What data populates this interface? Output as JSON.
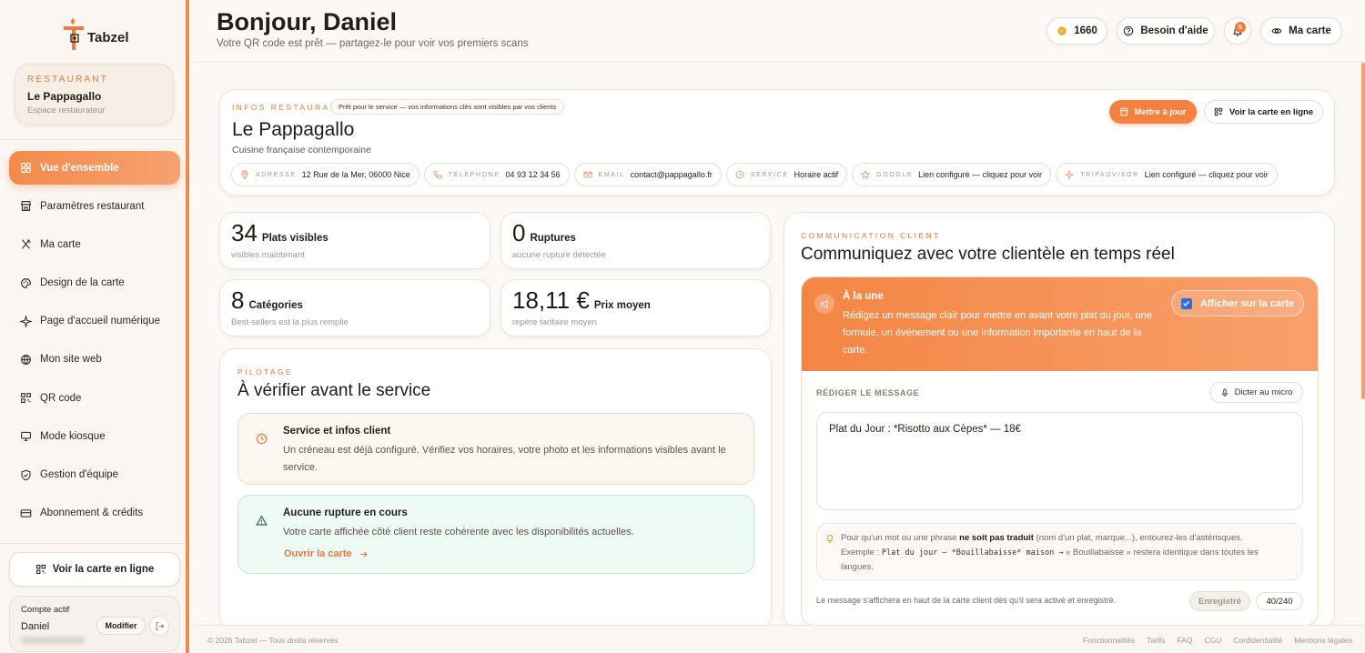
{
  "brand": {
    "name": "Tabzel",
    "accent": "#f4813f"
  },
  "sidebar": {
    "restaurant_label": "RESTAURANT",
    "restaurant_name": "Le Pappagallo",
    "restaurant_sub": "Espace restaurateur",
    "items": [
      {
        "label": "Vue d'ensemble",
        "icon": "grid-icon",
        "active": true
      },
      {
        "label": "Paramètres restaurant",
        "icon": "store-icon"
      },
      {
        "label": "Ma carte",
        "icon": "utensils-icon"
      },
      {
        "label": "Design de la carte",
        "icon": "palette-icon"
      },
      {
        "label": "Page d'accueil numérique",
        "icon": "sparkle-icon"
      },
      {
        "label": "Mon site web",
        "icon": "globe-icon"
      },
      {
        "label": "QR code",
        "icon": "qr-icon"
      },
      {
        "label": "Mode kiosque",
        "icon": "monitor-icon"
      },
      {
        "label": "Gestion d'équipe",
        "icon": "shield-icon"
      },
      {
        "label": "Abonnement & crédits",
        "icon": "card-icon"
      }
    ],
    "view_online": "Voir la carte en ligne",
    "account_label": "Compte actif",
    "account_name": "Daniel",
    "modify": "Modifier"
  },
  "header": {
    "title": "Bonjour, Daniel",
    "subtitle": "Votre QR code est prêt — partagez-le pour voir vos premiers scans",
    "credits": "1660",
    "help": "Besoin d'aide",
    "notif_count": "5",
    "my_menu": "Ma carte"
  },
  "info": {
    "eyebrow": "INFOS RESTAURANT",
    "badge": "Prêt pour le service — vos informations clés sont visibles par vos clients",
    "name": "Le Pappagallo",
    "cuisine": "Cuisine française contemporaine",
    "update_btn": "Mettre à jour",
    "view_btn": "Voir la carte en ligne",
    "chips": [
      {
        "key": "ADRESSE",
        "value": "12 Rue de la Mer, 06000 Nice",
        "icon": "pin-icon"
      },
      {
        "key": "TÉLÉPHONE",
        "value": "04 93 12 34 56",
        "icon": "phone-icon"
      },
      {
        "key": "EMAIL",
        "value": "contact@pappagallo.fr",
        "icon": "mail-icon"
      },
      {
        "key": "SERVICE",
        "value": "Horaire actif",
        "icon": "clock-icon"
      },
      {
        "key": "GOOGLE",
        "value": "Lien configuré — cliquez pour voir",
        "icon": "star-icon"
      },
      {
        "key": "TRIPADVISOR",
        "value": "Lien configuré — cliquez pour voir",
        "icon": "sparkle-icon"
      }
    ]
  },
  "stats": [
    {
      "num": "34",
      "label": "Plats visibles",
      "sub": "visibles maintenant"
    },
    {
      "num": "0",
      "label": "Ruptures",
      "sub": "aucune rupture détectée"
    },
    {
      "num": "8",
      "label": "Catégories",
      "sub": "Best-sellers est la plus remplie"
    },
    {
      "num": "18,11 €",
      "label": "Prix moyen",
      "sub": "repère tarifaire moyen"
    }
  ],
  "pilotage": {
    "eyebrow": "PILOTAGE",
    "title": "À vérifier avant le service",
    "c1_title": "Service et infos client",
    "c1_text": "Un créneau est déjà configuré. Vérifiez vos horaires, votre photo et les informations visibles avant le service.",
    "c2_title": "Aucune rupture en cours",
    "c2_text": "Votre carte affichée côté client reste cohérente avec les disponibilités actuelles.",
    "c2_link": "Ouvrir la carte"
  },
  "comm": {
    "eyebrow": "COMMUNICATION CLIENT",
    "title": "Communiquez avec votre clientèle en temps réel",
    "une_title": "À la une",
    "une_text": "Rédigez un message clair pour mettre en avant votre plat du jour, une formule, un événement ou une information importante en haut de la carte.",
    "show_label": "Afficher sur la carte",
    "write_label": "RÉDIGER LE MESSAGE",
    "dictate": "Dicter au micro",
    "message": "Plat du Jour : *Risotto aux Cèpes* — 18€",
    "tip_a": "Pour qu'un mot ou une phrase ",
    "tip_b": "ne soit pas traduit",
    "tip_c": " (nom d'un plat, marque...), entourez-les d'astérisques.",
    "tip_ex_label": "Exemple : ",
    "tip_ex_code": "Plat du jour — *Bouillabaisse* maison →",
    "tip_ex_rest": " « Bouillabaisse » restera identique dans toutes les langues.",
    "footnote": "Le message s'affichera en haut de la carte client dès qu'il sera activé et enregistré.",
    "save": "Enregistré",
    "count": "40/240"
  },
  "footer": {
    "copy": "© 2026 Tabzel — Tous droits réservés",
    "links": [
      "Fonctionnalités",
      "Tarifs",
      "FAQ",
      "CGU",
      "Confidentialité",
      "Mentions légales"
    ]
  }
}
